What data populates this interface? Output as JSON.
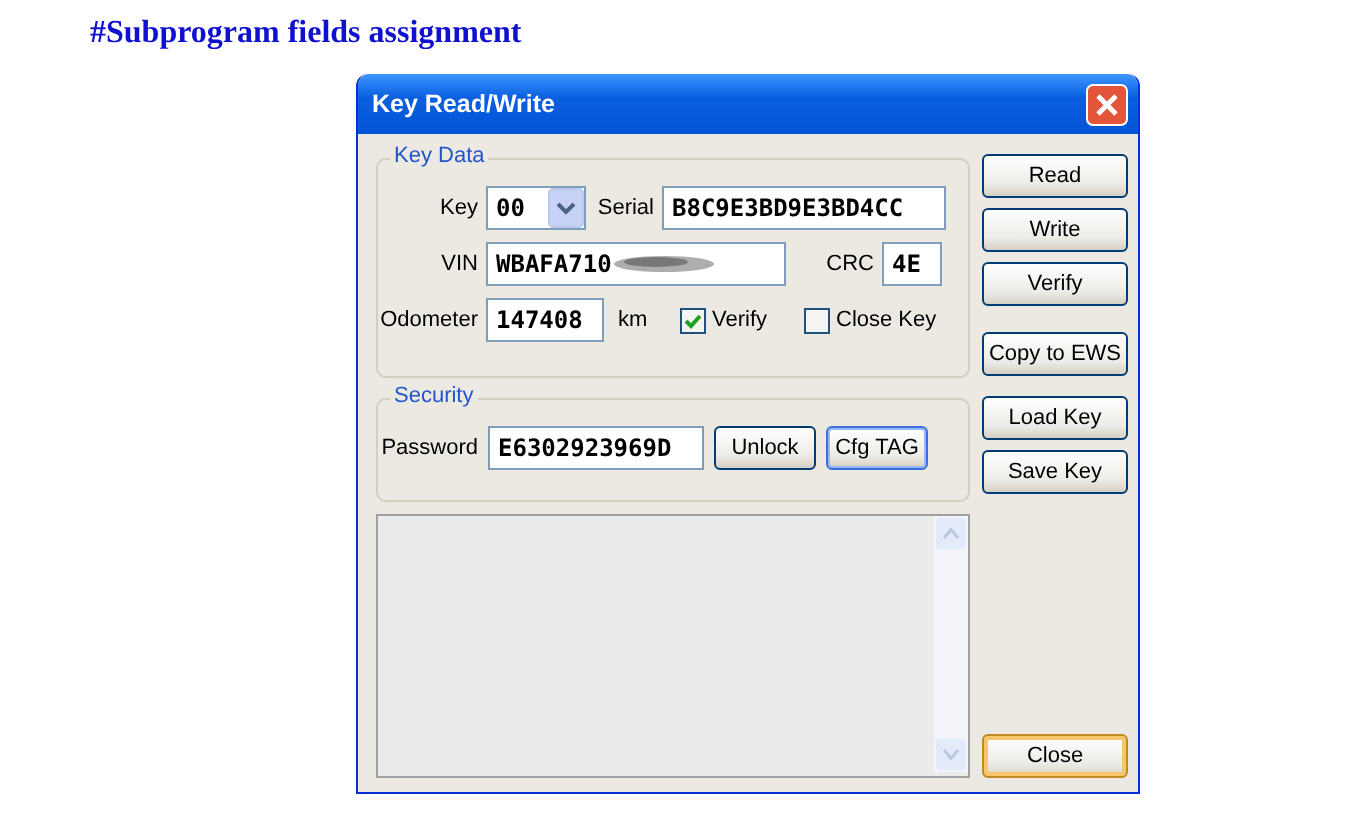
{
  "heading": "#Subprogram fields assignment",
  "window": {
    "title": "Key Read/Write"
  },
  "key_data": {
    "legend": "Key Data",
    "key_label": "Key",
    "key_value": "00",
    "serial_label": "Serial",
    "serial_value": "B8C9E3BD9E3BD4CC",
    "vin_label": "VIN",
    "vin_value": "WBAFA710",
    "crc_label": "CRC",
    "crc_value": "4E",
    "odometer_label": "Odometer",
    "odometer_value": "147408",
    "unit": "km",
    "checkboxes": [
      {
        "label": "Verify",
        "checked": true
      },
      {
        "label": "Close Key",
        "checked": false
      }
    ]
  },
  "security": {
    "legend": "Security",
    "password_label": "Password",
    "password_value": "E6302923969D",
    "buttons": [
      {
        "label": "Unlock",
        "focused": false
      },
      {
        "label": "Cfg TAG",
        "focused": true
      }
    ]
  },
  "side_buttons": [
    "Read",
    "Write",
    "Verify",
    "Copy to EWS",
    "Load Key",
    "Save Key"
  ],
  "close_button": {
    "label": "Close",
    "default": true
  }
}
